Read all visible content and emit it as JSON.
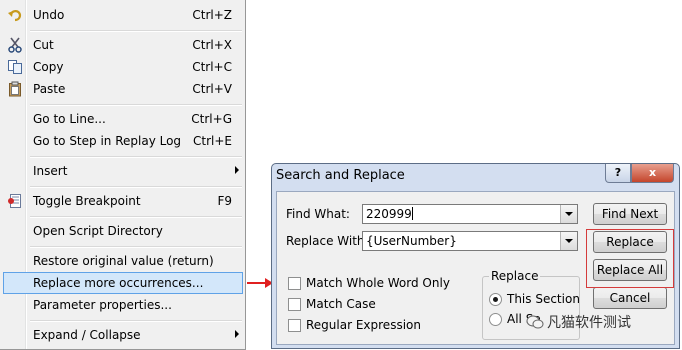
{
  "menu": {
    "items": [
      {
        "label": "Undo",
        "shortcut": "Ctrl+Z",
        "icon": "undo-icon"
      },
      {
        "label": "Cut",
        "shortcut": "Ctrl+X",
        "icon": "scissors-icon"
      },
      {
        "label": "Copy",
        "shortcut": "Ctrl+C",
        "icon": "copy-icon"
      },
      {
        "label": "Paste",
        "shortcut": "Ctrl+V",
        "icon": "paste-icon"
      },
      {
        "label": "Go to Line...",
        "shortcut": "Ctrl+G"
      },
      {
        "label": "Go to Step in Replay Log",
        "shortcut": "Ctrl+E"
      },
      {
        "label": "Insert",
        "submenu": true
      },
      {
        "label": "Toggle Breakpoint",
        "shortcut": "F9",
        "icon": "breakpoint-icon"
      },
      {
        "label": "Open Script Directory"
      },
      {
        "label": "Restore original value (return)"
      },
      {
        "label": "Replace more occurrences...",
        "highlighted": true
      },
      {
        "label": "Parameter properties..."
      },
      {
        "label": "Expand / Collapse",
        "submenu": true
      }
    ],
    "highlight_color": "#d3e7fa"
  },
  "dialog": {
    "title": "Search and Replace",
    "help_label": "?",
    "close_label": "x",
    "find_label": "Find What:",
    "find_value": "220999",
    "replace_label": "Replace With:",
    "replace_value": "{UserNumber}",
    "buttons": {
      "find_next": "Find Next",
      "replace": "Replace",
      "replace_all": "Replace All",
      "cancel": "Cancel"
    },
    "options": {
      "whole_word": "Match Whole Word Only",
      "match_case": "Match Case",
      "regex": "Regular Expression"
    },
    "scope": {
      "group_label": "Replace",
      "this_section": "This Section",
      "all_sections": "All Se"
    }
  },
  "watermark": {
    "text": "凡猫软件测试"
  },
  "colors": {
    "annotation_red": "#e02020",
    "dialog_frame": "#d3def0"
  }
}
